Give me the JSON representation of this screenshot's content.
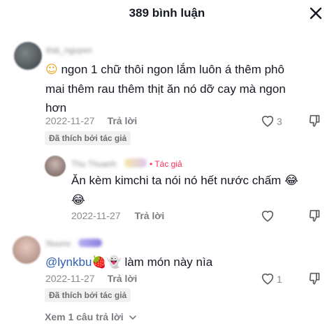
{
  "header": {
    "title": "389 bình luận"
  },
  "comments": [
    {
      "username": "thái_nguyen",
      "emoji": "☺",
      "text_lines": [
        "ngon 1 chữ thôi ngon lắm luôn á thêm phô",
        "mai thêm rau thêm thịt ăn nó dỡ cay mà ngon",
        "hơn"
      ],
      "date": "2022-11-27",
      "reply_label": "Trả lời",
      "likes": "3",
      "badge": "Đã thích bởi tác giả"
    },
    {
      "username": "Thu Thuanh",
      "author_tag": "Tác giả",
      "text_lines": [
        "Ăn kèm kimchi ta nói nó hết nước chấm"
      ],
      "laugh_emoji": "😂",
      "date": "2022-11-27",
      "reply_label": "Trả lời"
    },
    {
      "username": "Nuuno",
      "mention": "@lynkbu",
      "emojis": "🍓👻",
      "text": "làm món này nìa",
      "date": "2022-11-27",
      "reply_label": "Trả lời",
      "likes": "1",
      "badge": "Đã thích bởi tác giả",
      "view_replies": "Xem 1 câu trả lời"
    }
  ]
}
